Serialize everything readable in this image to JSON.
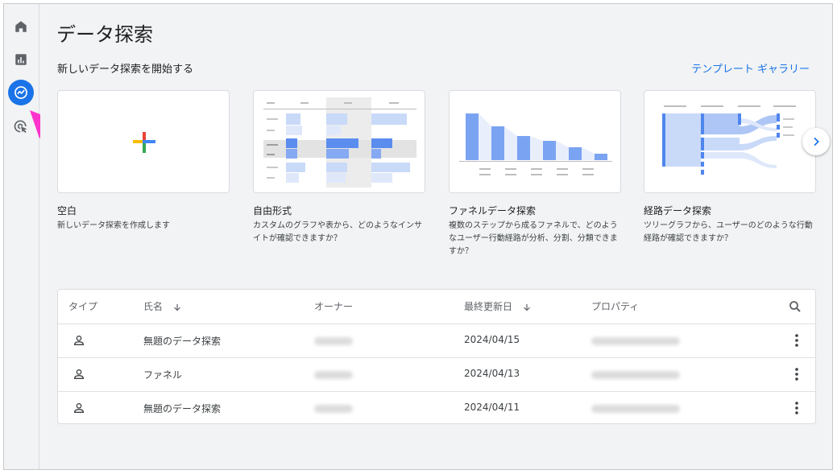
{
  "page": {
    "title": "データ探索",
    "section_title": "新しいデータ探索を開始する",
    "gallery_link": "テンプレート ギャラリー"
  },
  "sidebar": {
    "items": [
      {
        "name": "home",
        "icon": "home-icon"
      },
      {
        "name": "reports",
        "icon": "bar-chart-icon"
      },
      {
        "name": "explore",
        "icon": "explore-icon",
        "active": true
      },
      {
        "name": "advertising",
        "icon": "target-cursor-icon"
      }
    ]
  },
  "templates": [
    {
      "title": "空白",
      "description": "新しいデータ探索を作成します"
    },
    {
      "title": "自由形式",
      "description": "カスタムのグラフや表から、どのようなインサイトが確認できますか？"
    },
    {
      "title": "ファネルデータ探索",
      "description": "複数のステップから成るファネルで、どのようなユーザー行動経路が分析、分割、分類できますか？"
    },
    {
      "title": "経路データ探索",
      "description": "ツリーグラフから、ユーザーのどのような行動経路が確認できますか？"
    }
  ],
  "table": {
    "columns": [
      "タイプ",
      "氏名",
      "オーナー",
      "最終更新日",
      "プロパティ"
    ],
    "rows": [
      {
        "name": "無題のデータ探索",
        "updated": "2024/04/15"
      },
      {
        "name": "ファネル",
        "updated": "2024/04/13"
      },
      {
        "name": "無題のデータ探索",
        "updated": "2024/04/11"
      }
    ]
  },
  "colors": {
    "accent": "#1a73e8",
    "annotation_arrow": "#ff33cc"
  }
}
